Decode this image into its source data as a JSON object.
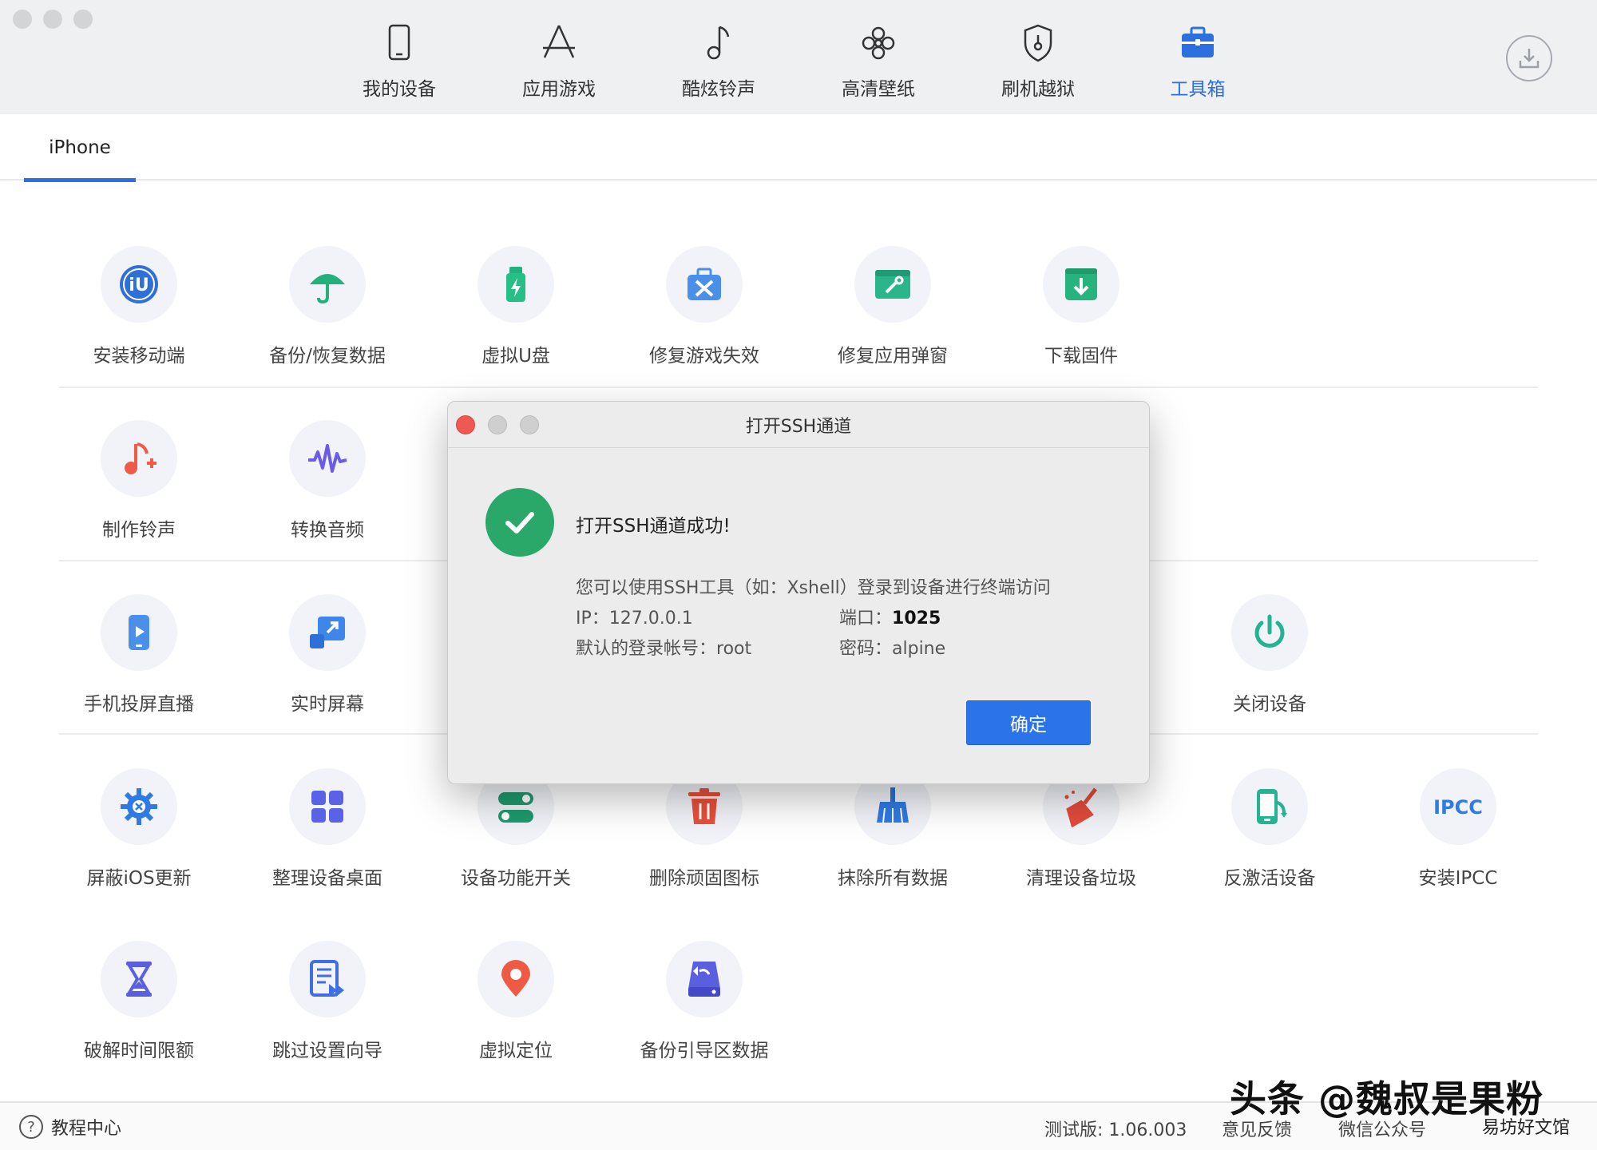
{
  "nav": {
    "items": [
      {
        "label": "我的设备",
        "icon": "phone-icon"
      },
      {
        "label": "应用游戏",
        "icon": "app-store-icon"
      },
      {
        "label": "酷炫铃声",
        "icon": "music-note-icon"
      },
      {
        "label": "高清壁纸",
        "icon": "flower-icon"
      },
      {
        "label": "刷机越狱",
        "icon": "shield-icon"
      },
      {
        "label": "工具箱",
        "icon": "toolbox-icon"
      }
    ],
    "active_index": 5,
    "accent_color": "#2b6fe0"
  },
  "device_tab": {
    "label": "iPhone"
  },
  "tools": [
    {
      "label": "安装移动端",
      "icon": "iu-logo-icon"
    },
    {
      "label": "备份/恢复数据",
      "icon": "umbrella-icon"
    },
    {
      "label": "虚拟U盘",
      "icon": "usb-drive-icon"
    },
    {
      "label": "修复游戏失效",
      "icon": "repair-kit-icon"
    },
    {
      "label": "修复应用弹窗",
      "icon": "wrench-window-icon"
    },
    {
      "label": "下载固件",
      "icon": "download-box-icon"
    },
    {
      "label": "制作铃声",
      "icon": "music-add-icon"
    },
    {
      "label": "转换音频",
      "icon": "waveform-icon"
    },
    {
      "label": "手机投屏直播",
      "icon": "phone-play-icon"
    },
    {
      "label": "实时屏幕",
      "icon": "screen-share-icon"
    },
    {
      "label": "关闭设备",
      "icon": "power-icon"
    },
    {
      "label": "屏蔽iOS更新",
      "icon": "gear-block-icon"
    },
    {
      "label": "整理设备桌面",
      "icon": "grid-apps-icon"
    },
    {
      "label": "设备功能开关",
      "icon": "toggle-icon"
    },
    {
      "label": "删除顽固图标",
      "icon": "trash-icon"
    },
    {
      "label": "抹除所有数据",
      "icon": "broom-icon"
    },
    {
      "label": "清理设备垃圾",
      "icon": "brush-clean-icon"
    },
    {
      "label": "反激活设备",
      "icon": "phone-deactivate-icon"
    },
    {
      "label": "安装IPCC",
      "icon": "ipcc-icon",
      "text": "IPCC"
    },
    {
      "label": "破解时间限额",
      "icon": "hourglass-icon"
    },
    {
      "label": "跳过设置向导",
      "icon": "skip-wizard-icon"
    },
    {
      "label": "虚拟定位",
      "icon": "location-pin-icon"
    },
    {
      "label": "备份引导区数据",
      "icon": "drive-backup-icon"
    }
  ],
  "dialog": {
    "title": "打开SSH通道",
    "success_message": "打开SSH通道成功!",
    "description": "您可以使用SSH工具（如：Xshell）登录到设备进行终端访问",
    "ip_label": "IP：",
    "ip_value": "127.0.0.1",
    "port_label": "端口：",
    "port_value": "1025",
    "account_label": "默认的登录帐号：",
    "account_value": "root",
    "password_label": "密码：",
    "password_value": "alpine",
    "ok_button": "确定",
    "success_color": "#29a86a",
    "button_color": "#2a73e8"
  },
  "footer": {
    "help": "教程中心",
    "version": "测试版: 1.06.003",
    "feedback": "意见反馈",
    "wechat": "微信公众号"
  },
  "watermark": {
    "main": "头条 @魏叔是果粉",
    "sub": "易坊好文馆"
  }
}
